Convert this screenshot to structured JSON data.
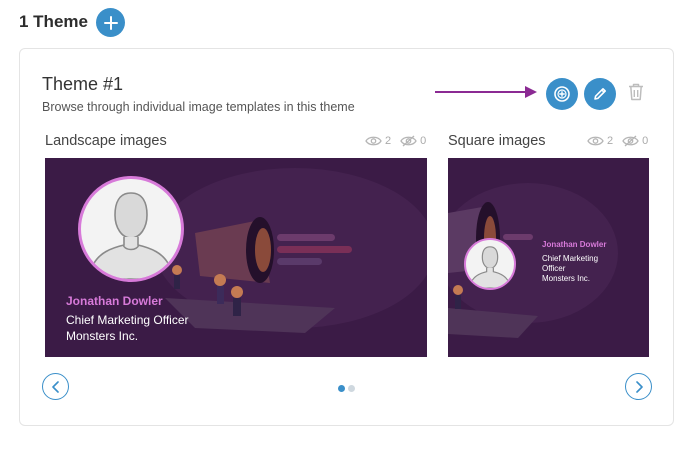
{
  "header": {
    "title": "1 Theme"
  },
  "theme": {
    "title": "Theme #1",
    "description": "Browse through individual image templates in this theme"
  },
  "sections": {
    "landscape": {
      "label": "Landscape images",
      "views": "2",
      "hidden": "0"
    },
    "square": {
      "label": "Square images",
      "views": "2",
      "hidden": "0"
    }
  },
  "preview": {
    "name": "Jonathan Dowler",
    "title": "Chief Marketing Officer",
    "title_line1": "Chief Marketing",
    "title_line2": "Officer",
    "company": "Monsters Inc."
  },
  "colors": {
    "accent": "#3a8fc9",
    "arrow": "#8b2a93",
    "preview_bg": "#3b1b46",
    "name_pink": "#d77ad9"
  },
  "icons": {
    "add": "plus-icon",
    "duplicate": "plus-circle-icon",
    "edit": "pencil-icon",
    "delete": "trash-icon",
    "views": "eye-icon",
    "hidden": "eye-off-icon",
    "prev": "chevron-left-icon",
    "next": "chevron-right-icon"
  },
  "carousel": {
    "current_page": 1,
    "total_pages": 2
  }
}
